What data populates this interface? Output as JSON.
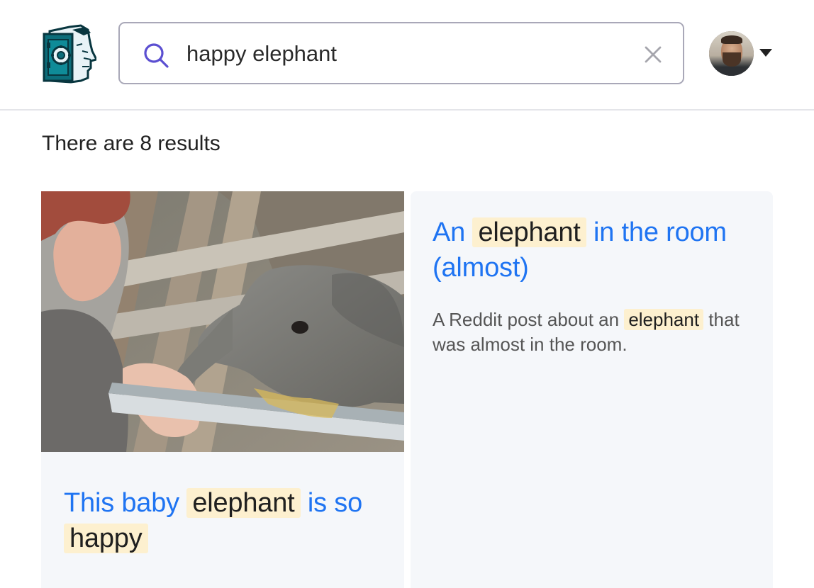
{
  "header": {
    "search": {
      "value": "happy elephant",
      "placeholder": ""
    },
    "icons": {
      "logo": "brain-vault-logo",
      "search": "search-icon",
      "clear": "close-icon",
      "dropdown": "caret-down-icon"
    }
  },
  "results": {
    "summary": "There are 8 results",
    "cards": [
      {
        "title_parts": [
          "This baby ",
          "elephant",
          " is so ",
          "happy"
        ],
        "image": "baby-elephant-with-woman-photo"
      },
      {
        "title_parts": [
          "An ",
          "elephant",
          " in the room (almost)"
        ],
        "description_parts": [
          "A Reddit post about an ",
          "elephant",
          " that was almost in the room."
        ]
      }
    ]
  },
  "colors": {
    "link": "#1f74f2",
    "highlight": "#fdf0cf",
    "card_background": "#f5f7fa",
    "search_icon": "#5b4fd1"
  }
}
